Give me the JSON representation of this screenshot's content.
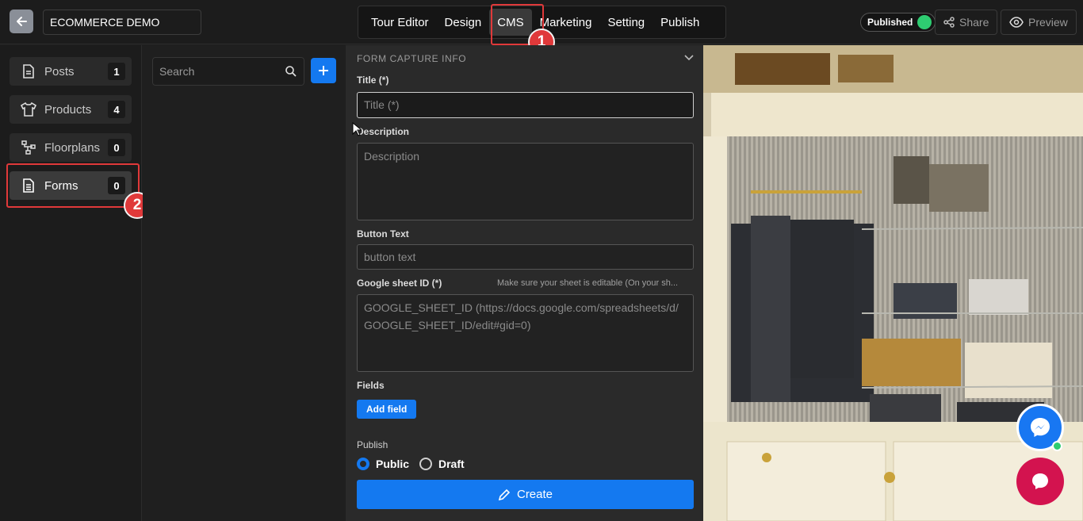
{
  "topbar": {
    "project_name": "ECOMMERCE DEMO",
    "nav": [
      "Tour Editor",
      "Design",
      "CMS",
      "Marketing",
      "Setting",
      "Publish"
    ],
    "active_nav": "CMS",
    "status_label": "Published",
    "share_label": "Share",
    "preview_label": "Preview",
    "annotation_1": "1",
    "annotation_2": "2"
  },
  "sidebar": {
    "items": [
      {
        "label": "Posts",
        "count": "1",
        "icon": "document-icon"
      },
      {
        "label": "Products",
        "count": "4",
        "icon": "shirt-icon"
      },
      {
        "label": "Floorplans",
        "count": "0",
        "icon": "floorplan-icon"
      },
      {
        "label": "Forms",
        "count": "0",
        "icon": "form-icon"
      }
    ],
    "active_item": "Forms"
  },
  "list": {
    "search_placeholder": "Search"
  },
  "form": {
    "section_title": "FORM CAPTURE INFO",
    "title_label": "Title (*)",
    "title_placeholder": "Title (*)",
    "description_label": "Description",
    "description_placeholder": "Description",
    "button_text_label": "Button Text",
    "button_text_placeholder": "button text",
    "sheet_label": "Google sheet ID (*)",
    "sheet_hint": "Make sure your sheet is editable (On your sh...",
    "sheet_placeholder": "GOOGLE_SHEET_ID (https://docs.google.com/spreadsheets/d/GOOGLE_SHEET_ID/edit#gid=0)",
    "fields_label": "Fields",
    "add_field_label": "Add field",
    "publish_label": "Publish",
    "publish_options": [
      "Public",
      "Draft"
    ],
    "publish_selected": "Public",
    "create_label": "Create"
  },
  "colors": {
    "accent": "#1479f0",
    "highlight": "#e0393a",
    "status_green": "#2ecc71",
    "messenger": "#1877f2",
    "chat": "#d3134f"
  }
}
